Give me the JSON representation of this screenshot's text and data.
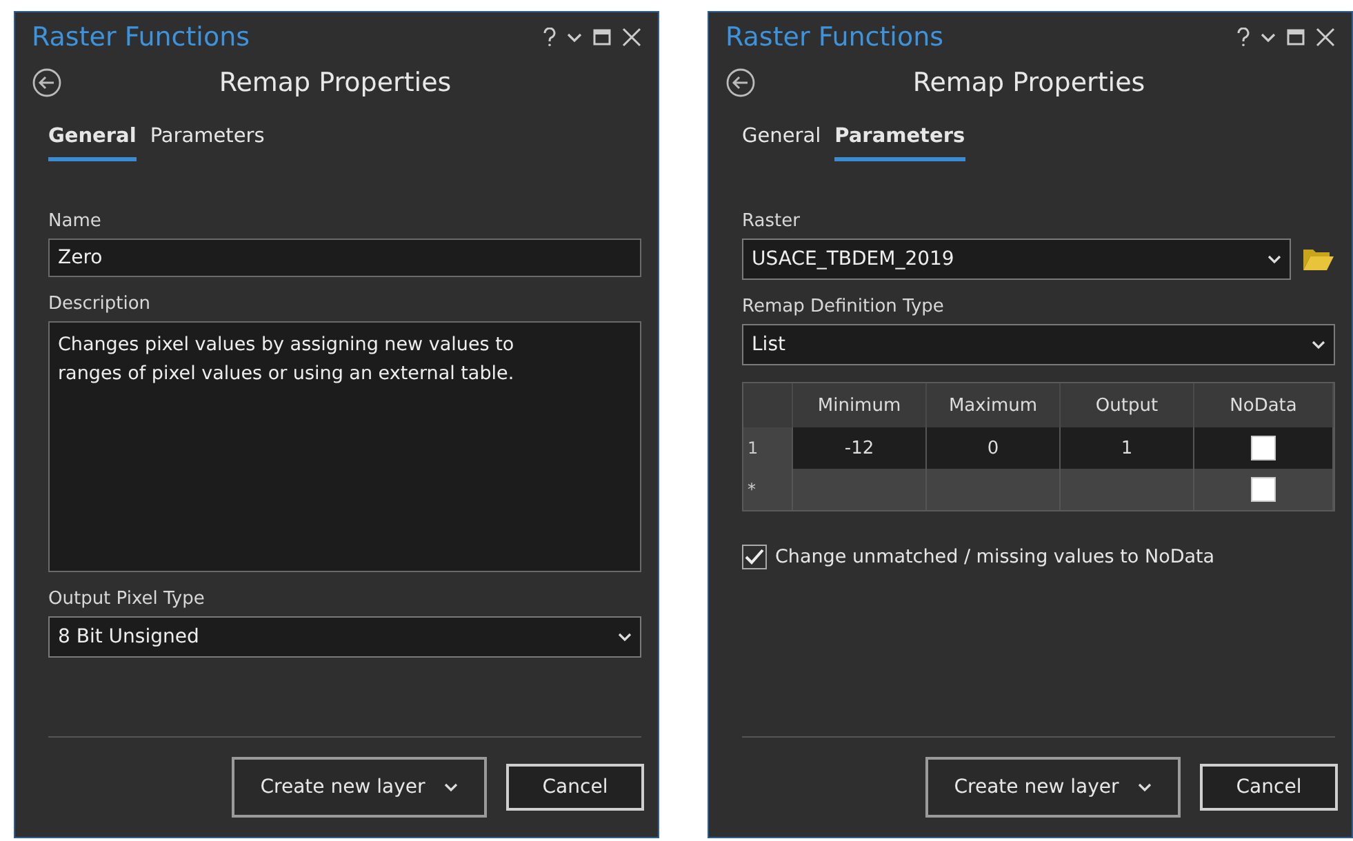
{
  "panels": [
    {
      "kind": "general",
      "title": "Raster Functions",
      "heading": "Remap Properties",
      "tabs": [
        {
          "label": "General",
          "selected": true
        },
        {
          "label": "Parameters",
          "selected": false
        }
      ],
      "name": {
        "label": "Name",
        "value": "Zero"
      },
      "description": {
        "label": "Description",
        "value": "Changes pixel values by assigning new values to ranges of pixel values or using an external table."
      },
      "pixel_type": {
        "label": "Output Pixel Type",
        "value": "8 Bit Unsigned"
      },
      "buttons": {
        "create": "Create new layer",
        "cancel": "Cancel"
      }
    },
    {
      "kind": "parameters",
      "title": "Raster Functions",
      "heading": "Remap Properties",
      "tabs": [
        {
          "label": "General",
          "selected": false
        },
        {
          "label": "Parameters",
          "selected": true
        }
      ],
      "raster": {
        "label": "Raster",
        "value": "USACE_TBDEM_2019"
      },
      "definition_type": {
        "label": "Remap Definition Type",
        "value": "List"
      },
      "table": {
        "columns": [
          "Minimum",
          "Maximum",
          "Output",
          "NoData"
        ],
        "rows": [
          {
            "marker": "1",
            "cells": [
              "-12",
              "0",
              "1"
            ],
            "nodata": false,
            "selected": true
          },
          {
            "marker": "*",
            "cells": [
              "",
              "",
              ""
            ],
            "nodata": false,
            "selected": false
          }
        ]
      },
      "unmatched": {
        "label": "Change unmatched / missing values to NoData",
        "checked": true
      },
      "buttons": {
        "create": "Create new layer",
        "cancel": "Cancel"
      }
    }
  ]
}
